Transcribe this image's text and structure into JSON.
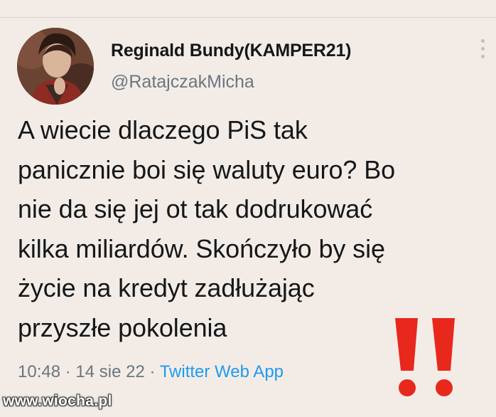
{
  "tweet": {
    "author_name": "Reginald Bundy(KAMPER21)",
    "author_handle": "@RatajczakMicha",
    "text": "A wiecie dlaczego PiS tak\npanicznie boi się waluty euro? Bo\nnie da się jej ot tak dodrukować\nkilka miliardów. Skończyło by się\nżycie na kredyt zadłużając\nprzyszłe pokolenia",
    "time": "10:48",
    "separator": " · ",
    "date": "14 sie 22",
    "source": "Twitter Web App"
  },
  "icons": {
    "more": "more-options-icon",
    "exclamation": "double-exclamation-icon"
  },
  "watermark": {
    "text": "www.wiocha.pl"
  },
  "colors": {
    "background": "#f3ece6",
    "text": "#14171a",
    "muted": "#6b7680",
    "link": "#1d9bf0",
    "exclamation": "#e8281d"
  }
}
